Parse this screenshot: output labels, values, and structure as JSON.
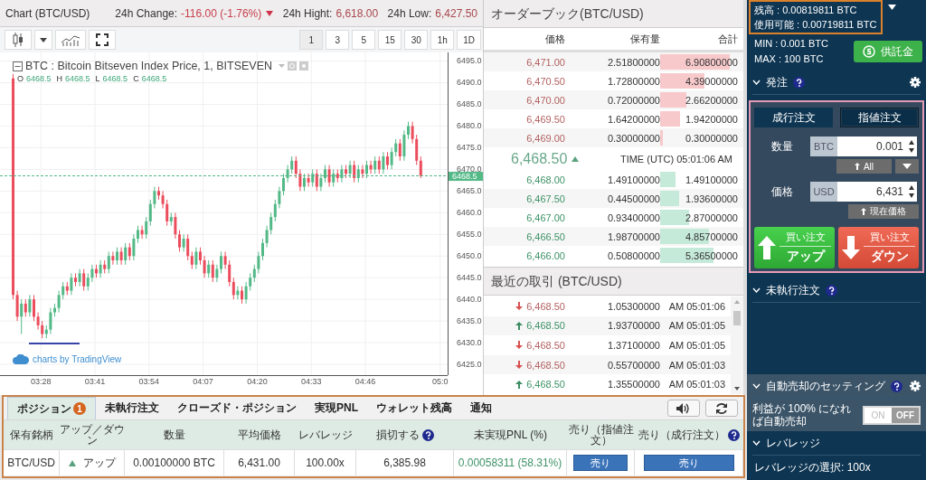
{
  "header": {
    "title": "Chart (BTC/USD)",
    "stats": [
      {
        "kind": "down",
        "label": "24h Change:",
        "value": "-116.00 (-1.76%)"
      },
      {
        "kind": "plain",
        "label": "24h Hight:",
        "value": "6,618.00"
      },
      {
        "kind": "plain",
        "label": "24h Low:",
        "value": "6,427.50"
      }
    ]
  },
  "chart_toolbar": {
    "intervals": [
      {
        "label": "1",
        "selected": true
      },
      {
        "label": "3",
        "selected": false
      },
      {
        "label": "5",
        "selected": false
      },
      {
        "label": "15",
        "selected": false
      },
      {
        "label": "30",
        "selected": false
      },
      {
        "label": "1h",
        "selected": false
      },
      {
        "label": "1D",
        "selected": false
      }
    ]
  },
  "chart": {
    "legend": "BTC : Bitcoin Bitseven Index Price, 1, BITSEVEN",
    "ohlc_legend": [
      {
        "key": "O",
        "value": "6468.5"
      },
      {
        "key": "H",
        "value": "6468.5"
      },
      {
        "key": "L",
        "value": "6468.5"
      },
      {
        "key": "C",
        "value": "6468.5"
      }
    ],
    "price_tag": "6468.5",
    "attribution": "charts by TradingView",
    "chart_data": {
      "type": "candlestick",
      "categories": [
        null,
        null,
        null,
        null,
        null,
        null,
        null,
        "03:28",
        null,
        null,
        null,
        null,
        null,
        null,
        null,
        null,
        null,
        null,
        null,
        null,
        "03:41",
        null,
        null,
        null,
        null,
        null,
        null,
        null,
        null,
        null,
        null,
        null,
        null,
        "03:54",
        null,
        null,
        null,
        null,
        null,
        null,
        null,
        null,
        null,
        null,
        null,
        null,
        "04:07",
        null,
        null,
        null,
        null,
        null,
        null,
        null,
        null,
        null,
        null,
        null,
        null,
        "04:20",
        null,
        null,
        null,
        null,
        null,
        null,
        null,
        null,
        null,
        null,
        null,
        null,
        "04:33",
        null,
        null,
        null,
        null,
        null,
        null,
        null,
        null,
        null,
        null,
        null,
        null,
        "04:46",
        null,
        null,
        null,
        null,
        null,
        null,
        null,
        null,
        null,
        null,
        null,
        null,
        null,
        null,
        null,
        null,
        null,
        "05:0"
      ],
      "ohlc": [
        [
          6491,
          6492,
          6440,
          6441
        ],
        [
          6441,
          6442,
          6435,
          6436
        ],
        [
          6436,
          6440,
          6432,
          6439
        ],
        [
          6439,
          6440,
          6436,
          6437
        ],
        [
          6437,
          6441,
          6436,
          6440
        ],
        [
          6440,
          6441,
          6435,
          6436
        ],
        [
          6436,
          6437,
          6433,
          6434
        ],
        [
          6434,
          6435,
          6431,
          6432
        ],
        [
          6432,
          6434,
          6431,
          6433
        ],
        [
          6433,
          6438,
          6432,
          6437
        ],
        [
          6437,
          6439,
          6436,
          6438
        ],
        [
          6438,
          6442,
          6437,
          6441
        ],
        [
          6441,
          6444,
          6440,
          6443
        ],
        [
          6443,
          6444,
          6441,
          6442
        ],
        [
          6442,
          6446,
          6441,
          6445
        ],
        [
          6445,
          6446,
          6443,
          6444
        ],
        [
          6444,
          6447,
          6443,
          6446
        ],
        [
          6446,
          6447,
          6442,
          6443
        ],
        [
          6443,
          6446,
          6442,
          6445
        ],
        [
          6445,
          6448,
          6444,
          6447
        ],
        [
          6447,
          6448,
          6445,
          6446
        ],
        [
          6446,
          6449,
          6445,
          6448
        ],
        [
          6448,
          6449,
          6446,
          6447
        ],
        [
          6447,
          6451,
          6446,
          6450
        ],
        [
          6450,
          6451,
          6448,
          6449
        ],
        [
          6449,
          6452,
          6448,
          6451
        ],
        [
          6451,
          6452,
          6448,
          6449
        ],
        [
          6449,
          6453,
          6448,
          6452
        ],
        [
          6452,
          6453,
          6449,
          6450
        ],
        [
          6450,
          6455,
          6449,
          6454
        ],
        [
          6454,
          6457,
          6453,
          6456
        ],
        [
          6456,
          6457,
          6454,
          6455
        ],
        [
          6455,
          6459,
          6454,
          6458
        ],
        [
          6458,
          6463,
          6457,
          6462
        ],
        [
          6462,
          6466,
          6461,
          6465
        ],
        [
          6465,
          6466,
          6463,
          6464
        ],
        [
          6464,
          6465,
          6461,
          6462
        ],
        [
          6462,
          6463,
          6457,
          6458
        ],
        [
          6458,
          6460,
          6457,
          6459
        ],
        [
          6459,
          6460,
          6454,
          6455
        ],
        [
          6455,
          6456,
          6451,
          6452
        ],
        [
          6452,
          6455,
          6451,
          6454
        ],
        [
          6454,
          6455,
          6449,
          6450
        ],
        [
          6450,
          6451,
          6447,
          6448
        ],
        [
          6448,
          6452,
          6447,
          6451
        ],
        [
          6451,
          6452,
          6448,
          6449
        ],
        [
          6449,
          6450,
          6445,
          6446
        ],
        [
          6446,
          6449,
          6445,
          6448
        ],
        [
          6448,
          6449,
          6444,
          6445
        ],
        [
          6445,
          6448,
          6444,
          6447
        ],
        [
          6447,
          6451,
          6446,
          6450
        ],
        [
          6450,
          6451,
          6447,
          6448
        ],
        [
          6448,
          6449,
          6443,
          6444
        ],
        [
          6444,
          6445,
          6440,
          6441
        ],
        [
          6441,
          6443,
          6440,
          6442
        ],
        [
          6442,
          6443,
          6439,
          6440
        ],
        [
          6440,
          6444,
          6439,
          6443
        ],
        [
          6443,
          6446,
          6442,
          6445
        ],
        [
          6445,
          6448,
          6444,
          6447
        ],
        [
          6447,
          6451,
          6446,
          6450
        ],
        [
          6450,
          6454,
          6449,
          6453
        ],
        [
          6453,
          6457,
          6452,
          6456
        ],
        [
          6456,
          6460,
          6455,
          6459
        ],
        [
          6459,
          6463,
          6458,
          6462
        ],
        [
          6462,
          6466,
          6461,
          6465
        ],
        [
          6465,
          6469,
          6464,
          6468
        ],
        [
          6468,
          6471,
          6467,
          6470
        ],
        [
          6470,
          6473,
          6469,
          6472
        ],
        [
          6472,
          6473,
          6468,
          6469
        ],
        [
          6469,
          6470,
          6465,
          6466
        ],
        [
          6466,
          6469,
          6465,
          6468
        ],
        [
          6468,
          6469,
          6466,
          6467
        ],
        [
          6467,
          6470,
          6466,
          6469
        ],
        [
          6469,
          6470,
          6465,
          6466
        ],
        [
          6466,
          6469,
          6465,
          6468
        ],
        [
          6468,
          6471,
          6467,
          6470
        ],
        [
          6470,
          6471,
          6466,
          6467
        ],
        [
          6467,
          6470,
          6466,
          6469
        ],
        [
          6469,
          6470,
          6467,
          6468
        ],
        [
          6468,
          6471,
          6467,
          6470
        ],
        [
          6470,
          6471,
          6468,
          6469
        ],
        [
          6469,
          6472,
          6468,
          6471
        ],
        [
          6471,
          6472,
          6467,
          6468
        ],
        [
          6468,
          6471,
          6467,
          6470
        ],
        [
          6470,
          6471,
          6468,
          6469
        ],
        [
          6469,
          6472,
          6468,
          6471
        ],
        [
          6471,
          6472,
          6469,
          6470
        ],
        [
          6470,
          6473,
          6469,
          6472
        ],
        [
          6472,
          6473,
          6469,
          6470
        ],
        [
          6470,
          6474,
          6469,
          6473
        ],
        [
          6473,
          6474,
          6470,
          6471
        ],
        [
          6471,
          6475,
          6470,
          6474
        ],
        [
          6474,
          6477,
          6473,
          6476
        ],
        [
          6476,
          6477,
          6472,
          6473
        ],
        [
          6473,
          6479,
          6472,
          6478
        ],
        [
          6478,
          6481,
          6477,
          6480
        ],
        [
          6480,
          6481,
          6476,
          6477
        ],
        [
          6477,
          6478,
          6471,
          6472
        ],
        [
          6472,
          6473,
          6468,
          6468.5
        ],
        null,
        null,
        null,
        null,
        null
      ],
      "ylim": [
        6422.5,
        6497
      ],
      "grid": true,
      "yticks": [
        {
          "value": 6495,
          "label": "6495.0"
        },
        {
          "value": 6490,
          "label": "6490.0"
        },
        {
          "value": 6485,
          "label": "6485.0"
        },
        {
          "value": 6480,
          "label": "6480.0"
        },
        {
          "value": 6475,
          "label": "6475.0"
        },
        {
          "value": 6470,
          "label": "6470.0"
        },
        {
          "value": 6465,
          "label": "6465.0"
        },
        {
          "value": 6460,
          "label": "6460.0"
        },
        {
          "value": 6455,
          "label": "6455.0"
        },
        {
          "value": 6450,
          "label": "6450.0"
        },
        {
          "value": 6445,
          "label": "6445.0"
        },
        {
          "value": 6440,
          "label": "6440.0"
        },
        {
          "value": 6435,
          "label": "6435.0"
        },
        {
          "value": 6430,
          "label": "6430.0"
        },
        {
          "value": 6425,
          "label": "6425.0"
        }
      ]
    }
  },
  "order_book": {
    "title": "オーダーブック(BTC/USD)",
    "columns": [
      "価格",
      "保有量",
      "合計"
    ],
    "asks": [
      {
        "price": "6,471.00",
        "amount": "2.51800000",
        "total": "6.90800000"
      },
      {
        "price": "6,470.50",
        "amount": "1.72800000",
        "total": "4.39000000"
      },
      {
        "price": "6,470.00",
        "amount": "0.72000000",
        "total": "2.66200000"
      },
      {
        "price": "6,469.50",
        "amount": "1.64200000",
        "total": "1.94200000"
      },
      {
        "price": "6,469.00",
        "amount": "0.30000000",
        "total": "0.30000000"
      }
    ],
    "last_price": "6,468.50",
    "rising": true,
    "time": "TIME (UTC) 05:01:06 AM",
    "bids": [
      {
        "price": "6,468.00",
        "amount": "1.49100000",
        "total": "1.49100000"
      },
      {
        "price": "6,467.50",
        "amount": "0.44500000",
        "total": "1.93600000"
      },
      {
        "price": "6,467.00",
        "amount": "0.93400000",
        "total": "2.87000000"
      },
      {
        "price": "6,466.50",
        "amount": "1.98700000",
        "total": "4.85700000"
      },
      {
        "price": "6,466.00",
        "amount": "0.50800000",
        "total": "5.36500000"
      }
    ]
  },
  "recent_trades": {
    "title": "最近の取引 (BTC/USD)",
    "rows": [
      {
        "kind": "down",
        "price": "6,468.50",
        "amount": "1.05300000",
        "time": "AM 05:01:06"
      },
      {
        "kind": "up",
        "price": "6,468.50",
        "amount": "1.93700000",
        "time": "AM 05:01:05"
      },
      {
        "kind": "down",
        "price": "6,468.50",
        "amount": "1.37100000",
        "time": "AM 05:01:05"
      },
      {
        "kind": "down",
        "price": "6,468.50",
        "amount": "0.55700000",
        "time": "AM 05:01:03"
      },
      {
        "kind": "up",
        "price": "6,468.50",
        "amount": "1.35500000",
        "time": "AM 05:01:03"
      }
    ]
  },
  "account": {
    "balance": "残高 : 0.00819811 BTC",
    "available": "使用可能 : 0.00719811 BTC",
    "min": "MIN : 0.001 BTC",
    "max": "MAX : 100 BTC",
    "deposit_button": "供託金"
  },
  "order_form": {
    "title": "発注",
    "tabs": [
      {
        "label": "成行注文",
        "selected": false
      },
      {
        "label": "指値注文",
        "selected": true
      }
    ],
    "quantity": {
      "label": "数量",
      "unit": "BTC",
      "value": "0.001"
    },
    "all_button": "All",
    "price": {
      "label": "価格",
      "unit": "USD",
      "value": "6,431"
    },
    "current_price_button": "現在価格",
    "buttons": [
      {
        "kind": "up",
        "caption": "買い注文",
        "label": "アップ"
      },
      {
        "kind": "down",
        "caption": "買い注文",
        "label": "ダウン"
      }
    ]
  },
  "open_orders": {
    "title": "未執行注文"
  },
  "auto_sell": {
    "title": "自動売却のセッティング",
    "text": "利益が 100% になれば自動売却",
    "toggle": {
      "on_label": "ON",
      "off_label": "OFF",
      "on": false
    }
  },
  "leverage": {
    "title": "レバレッジ",
    "text": "レバレッジの選択: 100x"
  },
  "positions": {
    "tabs": [
      {
        "label": "ポジション",
        "badge": "1",
        "selected": true
      },
      {
        "label": "未執行注文",
        "selected": false
      },
      {
        "label": "クローズド・ポジション",
        "selected": false
      },
      {
        "label": "実現PNL",
        "selected": false
      },
      {
        "label": "ウォレット残高",
        "selected": false
      },
      {
        "label": "通知",
        "selected": false
      }
    ],
    "columns": [
      {
        "label": "保有銘柄"
      },
      {
        "label": "アップ／ダウン"
      },
      {
        "label": "数量"
      },
      {
        "label": "平均価格"
      },
      {
        "label": "レバレッジ"
      },
      {
        "label": "損切する",
        "help": true
      },
      {
        "label": "未実現PNL (%)"
      },
      {
        "label": "売り（指値注文）"
      },
      {
        "label": "売り（成行注文）",
        "help": true
      }
    ],
    "rows": [
      {
        "symbol": "BTC/USD",
        "kind": "up",
        "direction_label": "アップ",
        "quantity": "0.00100000 BTC",
        "avg_price": "6,431.00",
        "leverage": "100.00x",
        "stop_loss": "6,385.98",
        "pnl": "0.00058311 (58.31%)",
        "limit_sell": "売り",
        "market_sell": "売り"
      }
    ]
  }
}
